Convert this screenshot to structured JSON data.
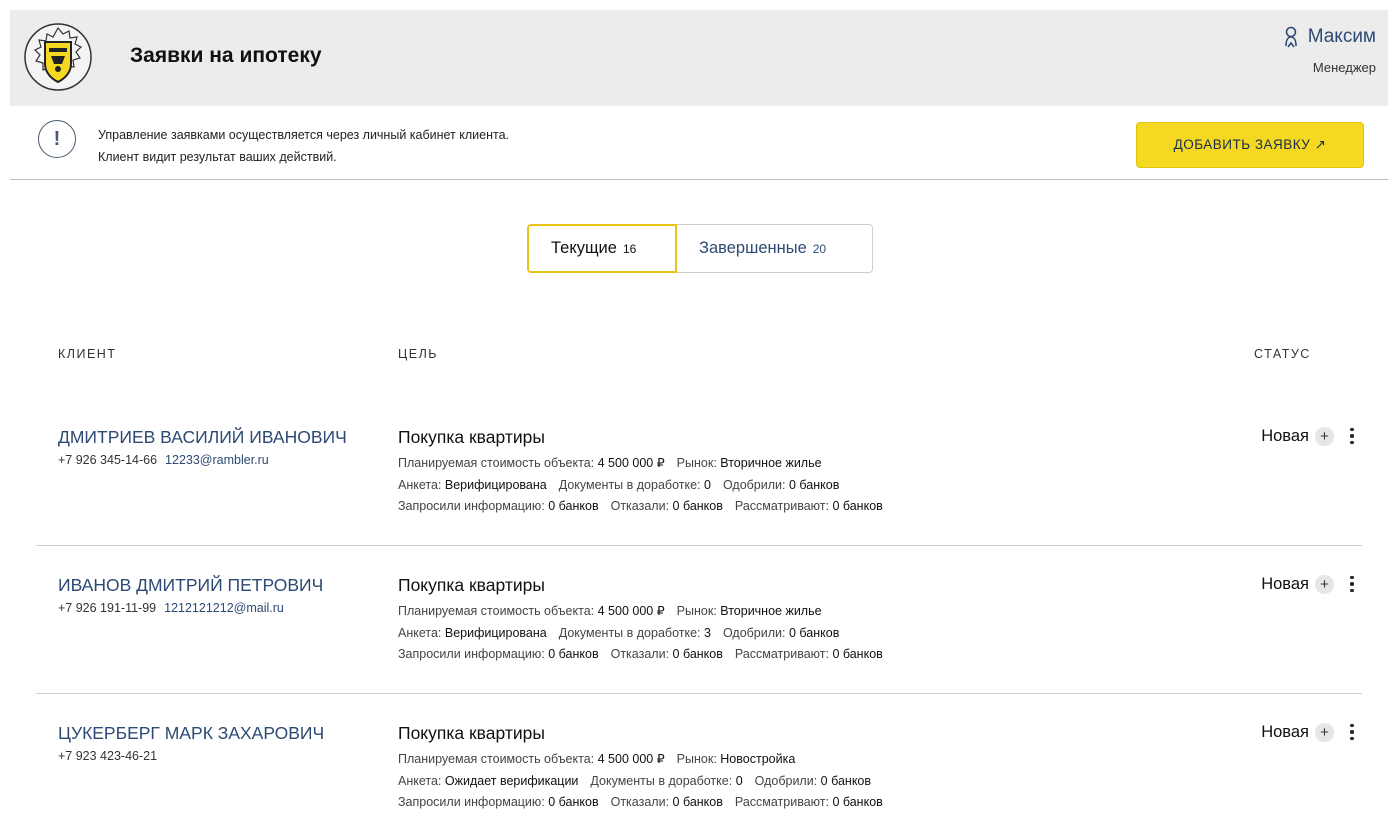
{
  "header": {
    "title": "Заявки на ипотеку",
    "user_name": "Максим",
    "user_role": "Менеджер",
    "logo_icon": "tinkoff-shield-logo",
    "user_icon": "user-icon"
  },
  "notice": {
    "line1": "Управление заявками осуществляется через личный кабинет клиента.",
    "line2": "Клиент видит результат ваших действий.",
    "icon": "exclamation-icon",
    "add_button_label": "ДОБАВИТЬ ЗАЯВКУ ↗"
  },
  "tabs": [
    {
      "label": "Текущие",
      "count": "16"
    },
    {
      "label": "Завершенные",
      "count": "20"
    }
  ],
  "columns": {
    "client": "КЛИЕНТ",
    "goal": "ЦЕЛЬ",
    "status": "СТАТУС"
  },
  "field_labels": {
    "price": "Планируемая стоимость объекта:",
    "market": "Рынок:",
    "form": "Анкета:",
    "docs": "Документы в доработке:",
    "approved": "Одобрили:",
    "requested": "Запросили информацию:",
    "rejected": "Отказали:",
    "reviewing": "Рассматривают:"
  },
  "rows": [
    {
      "name": "ДМИТРИЕВ ВАСИЛИЙ ИВАНОВИЧ",
      "phone": "+7 926 345-14-66",
      "email": "12233@rambler.ru",
      "goal": "Покупка квартиры",
      "price": "4 500 000 ₽",
      "market": "Вторичное жилье",
      "form": "Верифицирована",
      "docs": "0",
      "approved": "0 банков",
      "requested": "0 банков",
      "rejected": "0 банков",
      "reviewing": "0 банков",
      "status": "Новая"
    },
    {
      "name": "ИВАНОВ ДМИТРИЙ ПЕТРОВИЧ",
      "phone": "+7 926 191-11-99",
      "email": "1212121212@mail.ru",
      "goal": "Покупка квартиры",
      "price": "4 500 000 ₽",
      "market": "Вторичное жилье",
      "form": "Верифицирована",
      "docs": "3",
      "approved": "0 банков",
      "requested": "0 банков",
      "rejected": "0 банков",
      "reviewing": "0 банков",
      "status": "Новая"
    },
    {
      "name": "ЦУКЕРБЕРГ МАРК ЗАХАРОВИЧ",
      "phone": "+7 923 423-46-21",
      "email": "",
      "goal": "Покупка квартиры",
      "price": "4 500 000 ₽",
      "market": "Новостройка",
      "form": "Ожидает верификации",
      "docs": "0",
      "approved": "0 банков",
      "requested": "0 банков",
      "rejected": "0 банков",
      "reviewing": "0 банков",
      "status": "Новая"
    }
  ],
  "colors": {
    "accent": "#f5d821",
    "link": "#2d4a74",
    "header_bg": "#ececec"
  }
}
